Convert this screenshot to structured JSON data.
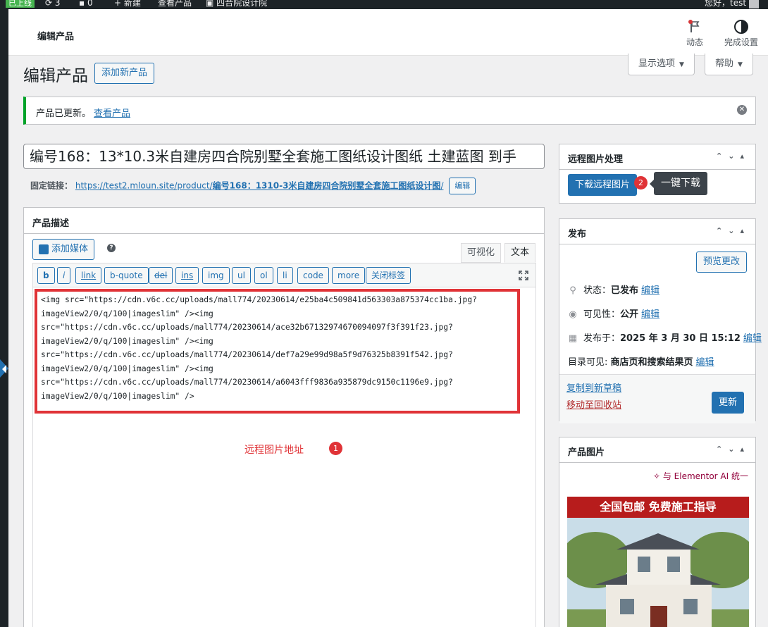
{
  "adminbar": {
    "env_label": "已上线",
    "updates_count": "3",
    "comments_count": "0",
    "new_label": "新建",
    "view_label": "查看产品",
    "site_name": "四合院设计院",
    "greeting": "您好，test"
  },
  "header": {
    "title": "编辑产品",
    "activity_label": "动态",
    "setup_label": "完成设置"
  },
  "screen_options": {
    "display_label": "显示选项",
    "help_label": "帮助"
  },
  "page": {
    "heading": "编辑产品",
    "add_new_label": "添加新产品"
  },
  "notice": {
    "message": "产品已更新。",
    "link_label": "查看产品"
  },
  "post": {
    "title": "编号168：13*10.3米自建房四合院别墅全套施工图纸设计图纸 土建蓝图 到手",
    "permalink_label": "固定链接：",
    "permalink_base": "https://test2.mloun.site/product/",
    "permalink_slug": "编号168：1310-3米自建房四合院别墅全套施工图纸设计图",
    "permalink_tail": "/",
    "permalink_edit": "编辑"
  },
  "editor": {
    "box_title": "产品描述",
    "add_media_label": "添加媒体",
    "help_glyph": "?",
    "tab_visual": "可视化",
    "tab_text": "文本",
    "qt_buttons": [
      "b",
      "i",
      "link",
      "b-quote",
      "del",
      "ins",
      "img",
      "ul",
      "ol",
      "li",
      "code",
      "more",
      "关闭标签"
    ],
    "content_lines": [
      "<img src=\"https://cdn.v6c.cc/uploads/mall774/20230614/e25ba4c509841d563303a875374cc1ba.jpg?",
      "imageView2/0/q/100|imageslim\" /><img",
      "src=\"https://cdn.v6c.cc/uploads/mall774/20230614/ace32b67132974670094097f3f391f23.jpg?",
      "imageView2/0/q/100|imageslim\" /><img",
      "src=\"https://cdn.v6c.cc/uploads/mall774/20230614/def7a29e99d98a5f9d76325b8391f542.jpg?",
      "imageView2/0/q/100|imageslim\" /><img",
      "src=\"https://cdn.v6c.cc/uploads/mall774/20230614/a6043fff9836a935879dc9150c1196e9.jpg?",
      "imageView2/0/q/100|imageslim\" />"
    ],
    "annotation_label": "远程图片地址",
    "annotation_num": "1"
  },
  "remote_box": {
    "title": "远程图片处理",
    "download_label": "下载远程图片",
    "badge_num": "2",
    "tooltip": "一键下载"
  },
  "publish_box": {
    "title": "发布",
    "preview_label": "预览更改",
    "status_label": "状态：",
    "status_value": "已发布",
    "visibility_label": "可见性：",
    "visibility_value": "公开",
    "published_label": "发布于：",
    "published_value": "2025 年 3 月 30 日 15:12",
    "catalog_label": "目录可见:",
    "catalog_value": "商店页和搜索结果页",
    "edit_label": "编辑",
    "copy_draft_label": "复制到新草稿",
    "trash_label": "移动至回收站",
    "update_label": "更新"
  },
  "product_image_box": {
    "title": "产品图片",
    "elementor_label": "与 Elementor AI 统一",
    "banner_text": "全国包邮  免费施工指导"
  },
  "colors": {
    "accent": "#2271b1",
    "annotation_red": "#e03337",
    "success_green": "#00a32a",
    "dark_bar": "#1d2327"
  }
}
